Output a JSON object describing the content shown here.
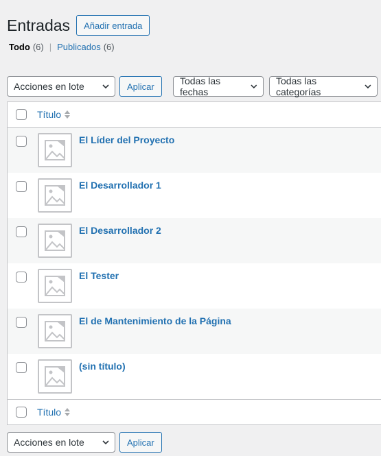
{
  "header": {
    "title": "Entradas",
    "add_label": "Añadir entrada"
  },
  "views": {
    "all": {
      "label": "Todo",
      "count": "(6)"
    },
    "separator": "|",
    "published": {
      "label": "Publicados",
      "count": "(6)"
    }
  },
  "bulk": {
    "label": "Acciones en lote",
    "apply": "Aplicar"
  },
  "filters": {
    "dates": "Todas las fechas",
    "categories": "Todas las categorías"
  },
  "table": {
    "column_title": "Título",
    "rows": [
      {
        "title": "El Líder del Proyecto"
      },
      {
        "title": "El Desarrollador 1"
      },
      {
        "title": "El Desarrollador 2"
      },
      {
        "title": "El Tester"
      },
      {
        "title": "El de Mantenimiento de la Página"
      },
      {
        "title": "(sin título)"
      }
    ]
  },
  "colors": {
    "accent": "#2271b1",
    "border": "#c3c4c7",
    "background": "#f0f0f1"
  },
  "icons": {
    "thumbnail": "image-placeholder-icon",
    "sort": "sort-arrows-icon",
    "dropdown": "chevron-down-icon"
  }
}
